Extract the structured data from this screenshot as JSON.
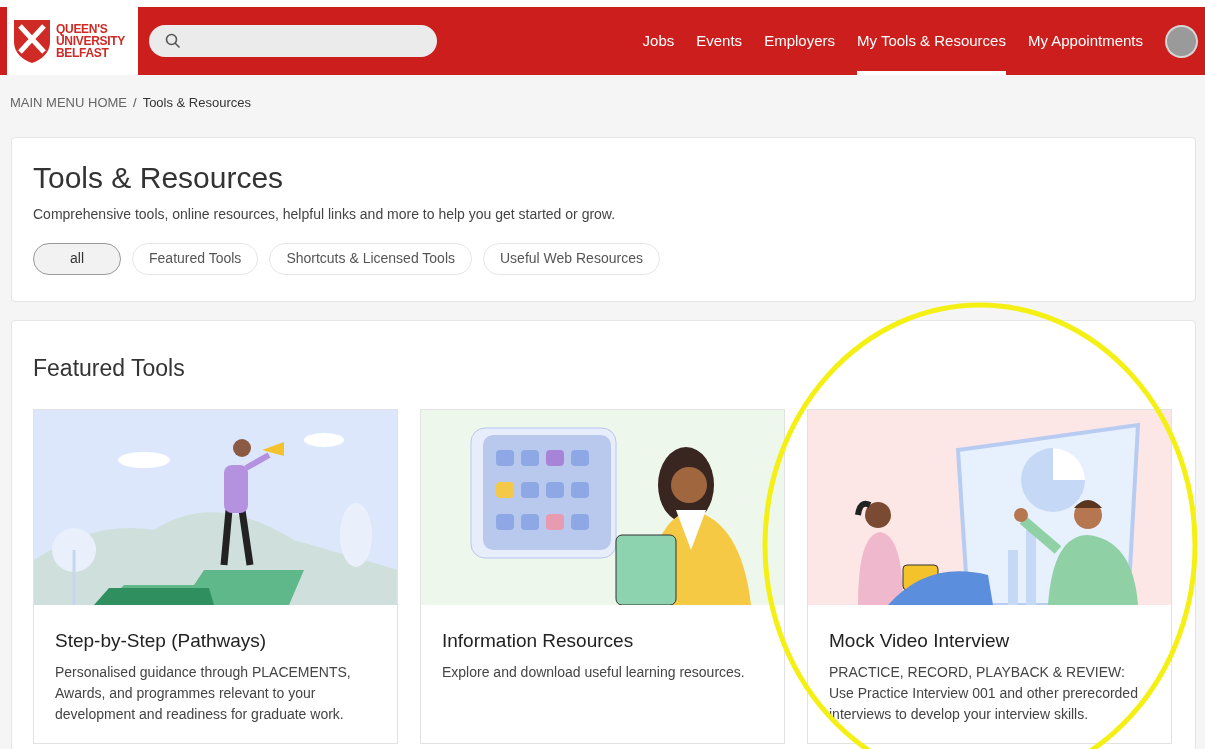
{
  "header": {
    "logo": [
      "QUEEN'S",
      "UNIVERSITY",
      "BELFAST"
    ],
    "nav": [
      {
        "label": "Jobs",
        "selected": false
      },
      {
        "label": "Events",
        "selected": false
      },
      {
        "label": "Employers",
        "selected": false
      },
      {
        "label": "My Tools & Resources",
        "selected": true
      },
      {
        "label": "My Appointments",
        "selected": false
      }
    ]
  },
  "breadcrumb": {
    "separator": "/",
    "items": [
      "MAIN MENU HOME",
      "Tools & Resources"
    ]
  },
  "intro": {
    "title": "Tools & Resources",
    "subtitle": "Comprehensive tools, online resources, helpful links and more to help you get started or grow.",
    "filters": [
      {
        "label": "all",
        "selected": true
      },
      {
        "label": "Featured Tools",
        "selected": false
      },
      {
        "label": "Shortcuts & Licensed Tools",
        "selected": false
      },
      {
        "label": "Useful Web Resources",
        "selected": false
      }
    ]
  },
  "featured": {
    "title": "Featured Tools",
    "cards": [
      {
        "kind": "pathways",
        "title": "Step-by-Step (Pathways)",
        "description": "Personalised guidance through PLACEMENTS, Awards, and programmes relevant to your development and readiness for graduate work."
      },
      {
        "kind": "resources",
        "title": "Information Resources",
        "description": "Explore and download useful learning resources."
      },
      {
        "kind": "interview",
        "title": "Mock Video Interview",
        "description": "PRACTICE, RECORD, PLAYBACK & REVIEW: Use Practice Interview 001 and other prerecorded interviews to develop your interview skills."
      }
    ]
  }
}
